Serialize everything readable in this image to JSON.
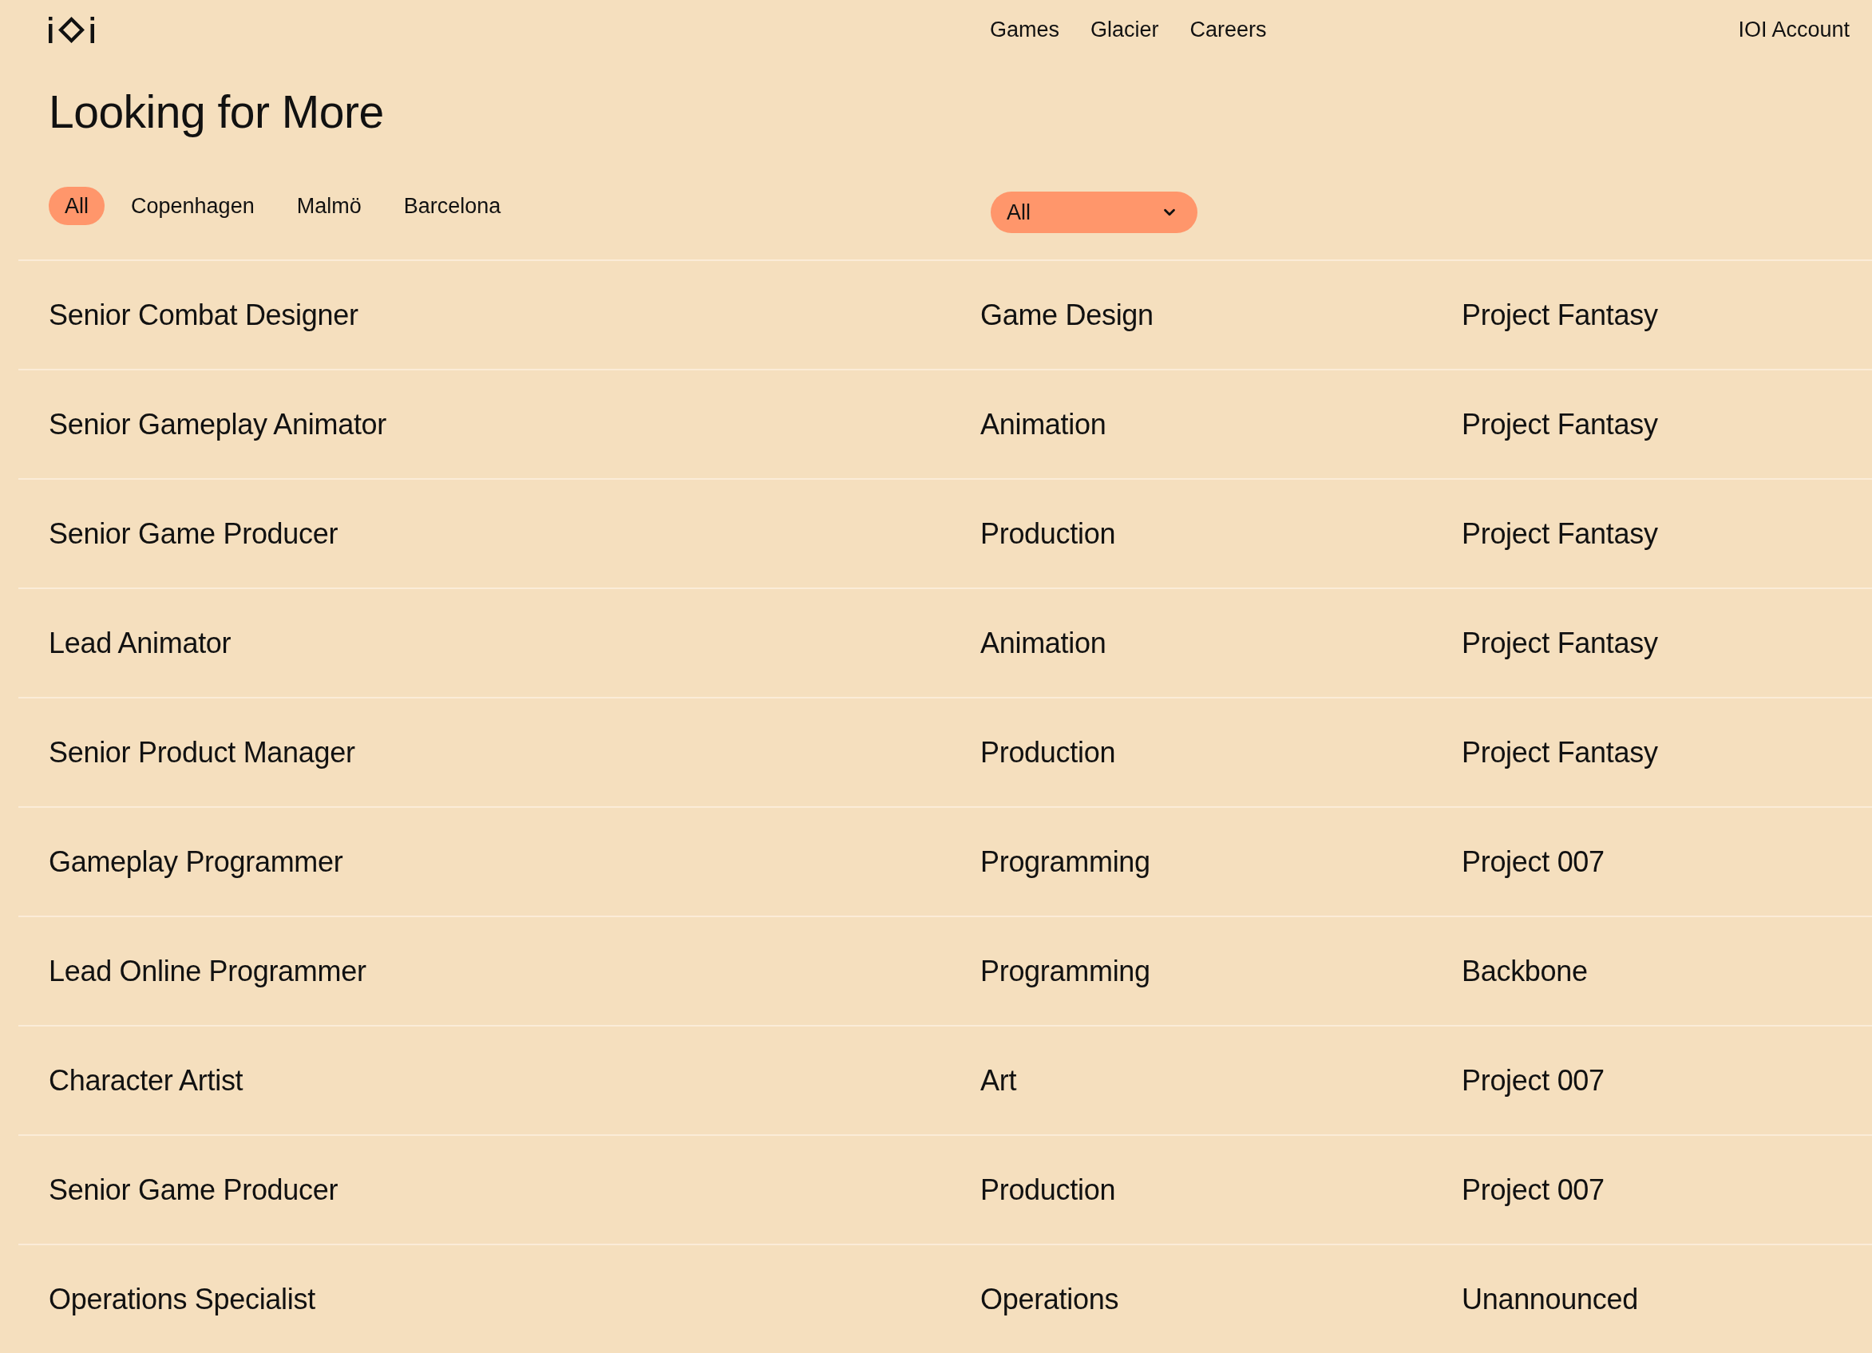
{
  "nav": {
    "links": [
      "Games",
      "Glacier",
      "Careers"
    ],
    "account": "IOI Account"
  },
  "heading": "Looking for More",
  "location_tabs": [
    {
      "label": "All",
      "selected": true
    },
    {
      "label": "Copenhagen",
      "selected": false
    },
    {
      "label": "Malmö",
      "selected": false
    },
    {
      "label": "Barcelona",
      "selected": false
    }
  ],
  "category_select": {
    "value": "All"
  },
  "jobs": [
    {
      "title": "Senior Combat Designer",
      "department": "Game Design",
      "project": "Project Fantasy"
    },
    {
      "title": "Senior Gameplay Animator",
      "department": "Animation",
      "project": "Project Fantasy"
    },
    {
      "title": "Senior Game Producer",
      "department": "Production",
      "project": "Project Fantasy"
    },
    {
      "title": "Lead Animator",
      "department": "Animation",
      "project": "Project Fantasy"
    },
    {
      "title": "Senior Product Manager",
      "department": "Production",
      "project": "Project Fantasy"
    },
    {
      "title": "Gameplay Programmer",
      "department": "Programming",
      "project": "Project 007"
    },
    {
      "title": "Lead Online Programmer",
      "department": "Programming",
      "project": "Backbone"
    },
    {
      "title": "Character Artist",
      "department": "Art",
      "project": "Project 007"
    },
    {
      "title": "Senior Game Producer",
      "department": "Production",
      "project": "Project 007"
    },
    {
      "title": "Operations Specialist",
      "department": "Operations",
      "project": "Unannounced"
    }
  ]
}
